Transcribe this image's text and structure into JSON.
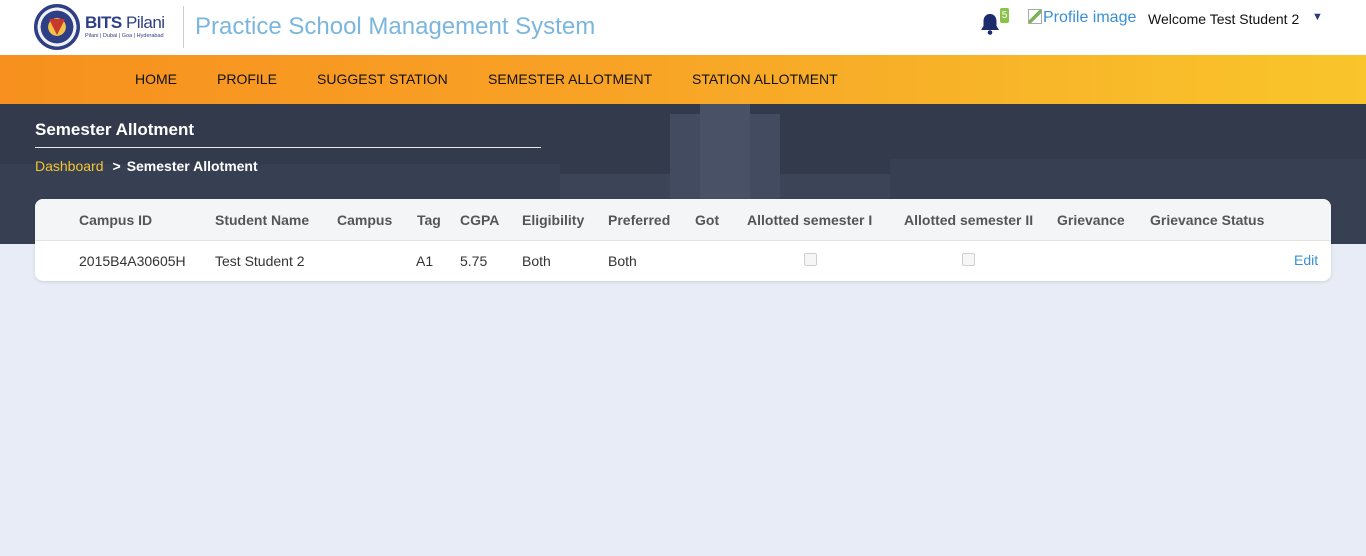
{
  "header": {
    "logo_name_bold": "BITS",
    "logo_name_rest": "Pilani",
    "logo_sub": "Pilani | Dubai | Goa | Hyderabad",
    "app_title": "Practice School Management System",
    "notification_count": "5",
    "profile_image_alt": "Profile image",
    "welcome_text": "Welcome Test Student 2",
    "caret": "▼"
  },
  "nav": {
    "items": [
      {
        "label": "HOME"
      },
      {
        "label": "PROFILE"
      },
      {
        "label": "SUGGEST STATION"
      },
      {
        "label": "SEMESTER ALLOTMENT"
      },
      {
        "label": "STATION ALLOTMENT"
      }
    ]
  },
  "banner": {
    "page_title": "Semester Allotment",
    "breadcrumb": {
      "link": "Dashboard",
      "separator": ">",
      "current": "Semester Allotment"
    }
  },
  "table": {
    "columns": [
      "Campus ID",
      "Student Name",
      "Campus",
      "Tag",
      "CGPA",
      "Eligibility",
      "Preferred",
      "Got",
      "Allotted semester I",
      "Allotted semester II",
      "Grievance",
      "Grievance Status"
    ],
    "rows": [
      {
        "campus_id": "2015B4A30605H",
        "student_name": "Test Student 2",
        "campus": "",
        "tag": "A1",
        "cgpa": "5.75",
        "eligibility": "Both",
        "preferred": "Both",
        "got": "",
        "allotted_sem_1": false,
        "allotted_sem_2": false,
        "grievance": "",
        "grievance_status": "",
        "action": "Edit"
      }
    ]
  },
  "colors": {
    "nav_gradient_start": "#f7901e",
    "nav_gradient_end": "#f9c52b",
    "banner_bg": "#323a4c",
    "page_bg": "#e8ecf6",
    "link_blue": "#3a8fd6",
    "breadcrumb_link": "#f4c430",
    "title_blue": "#7ab6dd"
  }
}
